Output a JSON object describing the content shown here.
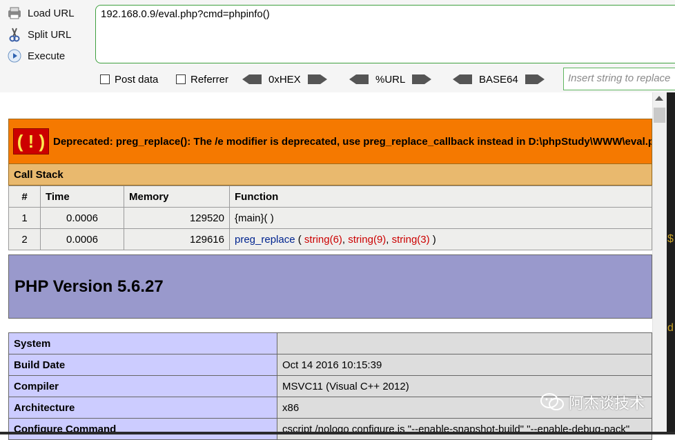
{
  "toolbar": {
    "load_url": "Load URL",
    "split_url": "Split URL",
    "execute": "Execute",
    "url_value": "192.168.0.9/eval.php?cmd=phpinfo()",
    "post_data": "Post data",
    "referrer": "Referrer",
    "hex": "0xHEX",
    "url_enc": "%URL",
    "base64": "BASE64",
    "insert_placeholder": "Insert string to replace"
  },
  "error": {
    "badge": "( ! )",
    "message": "Deprecated: preg_replace(): The /e modifier is deprecated, use preg_replace_callback instead in D:\\phpStudy\\WWW\\eval.php",
    "call_stack_title": "Call Stack",
    "columns": [
      "#",
      "Time",
      "Memory",
      "Function"
    ],
    "rows": [
      {
        "num": "1",
        "time": "0.0006",
        "memory": "129520",
        "func": "{main}( )"
      },
      {
        "num": "2",
        "time": "0.0006",
        "memory": "129616",
        "func_name": "preg_replace",
        "args": [
          "string(6)",
          "string(9)",
          "string(3)"
        ]
      }
    ],
    "punct": {
      "open": " ( ",
      "comma": ", ",
      "close": " )"
    }
  },
  "phpinfo": {
    "title": "PHP Version 5.6.27",
    "rows": [
      {
        "key": "System",
        "value": ""
      },
      {
        "key": "Build Date",
        "value": "Oct 14 2016 10:15:39"
      },
      {
        "key": "Compiler",
        "value": "MSVC11 (Visual C++ 2012)"
      },
      {
        "key": "Architecture",
        "value": "x86"
      },
      {
        "key": "Configure Command",
        "value": "cscript /nologo configure.js \"--enable-snapshot-build\" \"--enable-debug-pack\""
      }
    ]
  },
  "watermark": "阿杰谈技术",
  "side_chars": [
    "$",
    "d"
  ],
  "colors": {
    "error_orange": "#f57900",
    "callstack_tan": "#e9b96e",
    "php_purple": "#9999cc",
    "key_lavender": "#ccccff"
  }
}
